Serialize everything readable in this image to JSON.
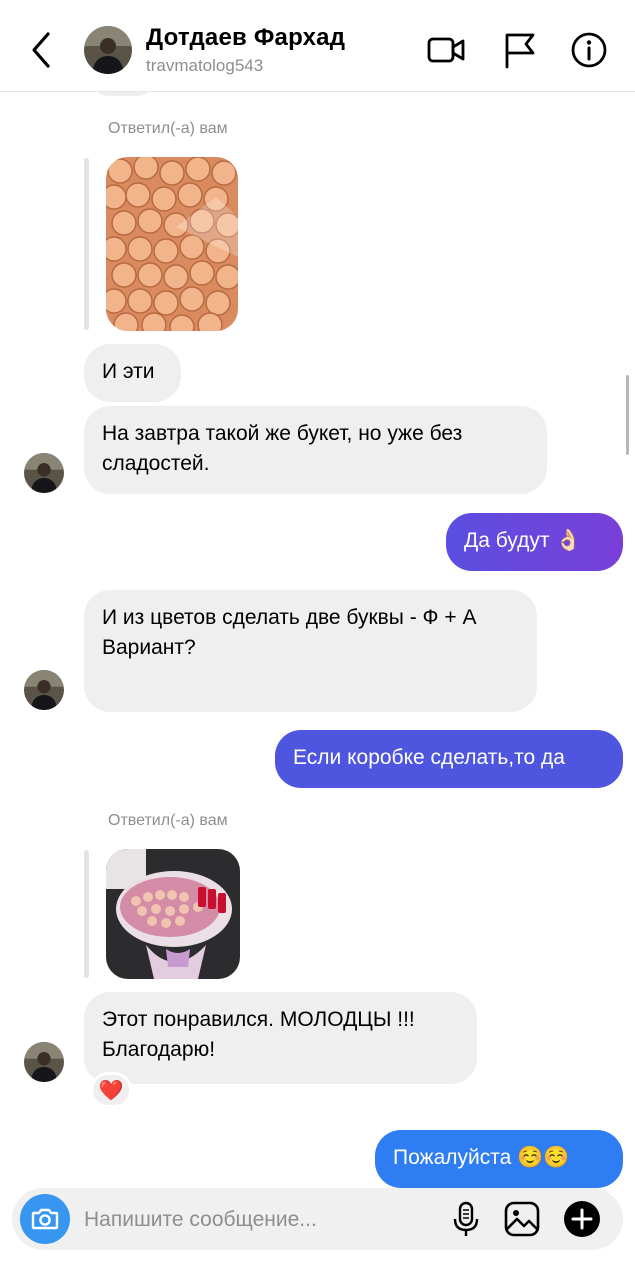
{
  "header": {
    "name": "Дотдаев Фархад",
    "username": "travmatolog543",
    "icons": [
      "back-icon",
      "video-call-icon",
      "flag-icon",
      "info-icon"
    ]
  },
  "messages": {
    "replied_label_1": "Ответил(-а) вам",
    "msg_i_eti": "И эти",
    "msg_zavtra": "На завтра такой же букет, но уже без сладостей.",
    "msg_da_budut": "Да будут 👌🏻",
    "msg_bukvy": "И из цветов сделать две буквы - Ф + А\nВариант?",
    "msg_korobke": "Если коробке сделать,то да",
    "replied_label_2": "Ответил(-а) вам",
    "msg_ponravilsya": "Этот понравился. МОЛОДЦЫ !!!\nБлагодарю!",
    "reaction": "❤️",
    "msg_pozhaluysta": "Пожалуйста ☺️☺️"
  },
  "composer": {
    "placeholder": "Напишите сообщение...",
    "icons": [
      "camera-icon",
      "microphone-icon",
      "gallery-icon",
      "plus-icon"
    ]
  },
  "colors": {
    "incoming_bubble": "#efefef",
    "outgoing_purple": "#6a45dc",
    "outgoing_indigo": "#4e56e0",
    "outgoing_blue": "#2f7df2",
    "camera_button": "#3797f0"
  }
}
